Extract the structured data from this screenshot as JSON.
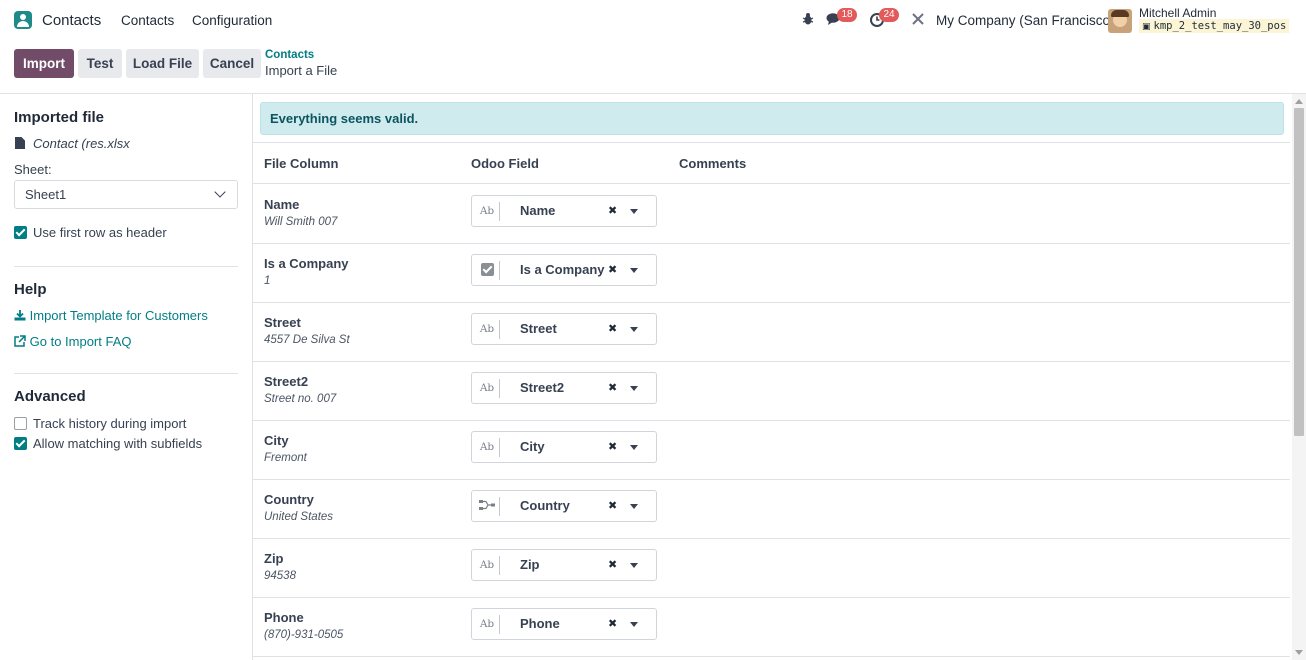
{
  "navbar": {
    "app_name": "Contacts",
    "menu": [
      "Contacts",
      "Configuration"
    ],
    "messages_count": "18",
    "activities_count": "24",
    "company": "My Company (San Francisco)",
    "user_name": "Mitchell Admin",
    "database": "kmp_2_test_may_30_pos"
  },
  "control_panel": {
    "import_label": "Import",
    "test_label": "Test",
    "load_file_label": "Load File",
    "cancel_label": "Cancel",
    "breadcrumb_parent": "Contacts",
    "breadcrumb_current": "Import a File"
  },
  "sidebar": {
    "imported_file_title": "Imported file",
    "file_name": "Contact (res.xlsx",
    "sheet_label": "Sheet:",
    "sheet_value": "Sheet1",
    "first_row_header_label": "Use first row as header",
    "first_row_header_checked": true,
    "help_title": "Help",
    "template_link": "Import Template for Customers",
    "faq_link": "Go to Import FAQ",
    "advanced_title": "Advanced",
    "track_history_label": "Track history during import",
    "track_history_checked": false,
    "allow_matching_label": "Allow matching with subfields",
    "allow_matching_checked": true
  },
  "main": {
    "alert_text": "Everything seems valid.",
    "headers": {
      "file_column": "File Column",
      "odoo_field": "Odoo Field",
      "comments": "Comments"
    },
    "rows": [
      {
        "column": "Name",
        "sample": "Will Smith 007",
        "field": "Name",
        "type_icon": "text-type-icon"
      },
      {
        "column": "Is a Company",
        "sample": "1",
        "field": "Is a Company",
        "type_icon": "checkbox-type-icon"
      },
      {
        "column": "Street",
        "sample": "4557 De Silva St",
        "field": "Street",
        "type_icon": "text-type-icon"
      },
      {
        "column": "Street2",
        "sample": "Street no. 007",
        "field": "Street2",
        "type_icon": "text-type-icon"
      },
      {
        "column": "City",
        "sample": "Fremont",
        "field": "City",
        "type_icon": "text-type-icon"
      },
      {
        "column": "Country",
        "sample": "United States",
        "field": "Country",
        "type_icon": "relation-type-icon"
      },
      {
        "column": "Zip",
        "sample": "94538",
        "field": "Zip",
        "type_icon": "text-type-icon"
      },
      {
        "column": "Phone",
        "sample": "(870)-931-0505",
        "field": "Phone",
        "type_icon": "text-type-icon"
      }
    ]
  },
  "colors": {
    "primary": "#714b67",
    "link": "#017e84",
    "alert_bg": "#d0ebee",
    "badge": "#e25a5a"
  }
}
